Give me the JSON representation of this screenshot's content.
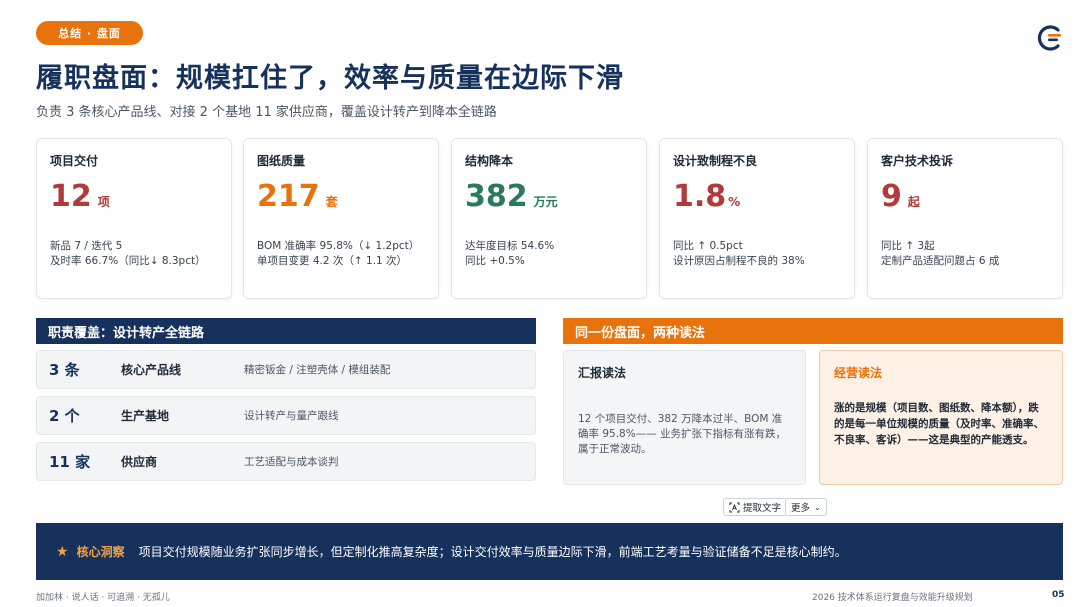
{
  "header": {
    "tag": "总结 · 盘面",
    "title": "履职盘面：规模扛住了，效率与质量在边际下滑",
    "subtitle": "负责 3 条核心产品线、对接 2 个基地 11 家供应商，覆盖设计转产到降本全链路"
  },
  "kpis": [
    {
      "label": "项目交付",
      "value": "12",
      "unit": "项",
      "color": "#b23a3a",
      "detail1": "新品 7 / 迭代 5",
      "detail2": "及时率 66.7%（同比↓ 8.3pct）"
    },
    {
      "label": "图纸质量",
      "value": "217",
      "unit": "套",
      "color": "#e8720c",
      "detail1": "BOM 准确率 95.8%（↓ 1.2pct）",
      "detail2": "单项目变更 4.2 次（↑ 1.1 次）"
    },
    {
      "label": "结构降本",
      "value": "382",
      "unit": "万元",
      "color": "#2b7a5a",
      "detail1": "达年度目标 54.6%",
      "detail2": "同比 +0.5%"
    },
    {
      "label": "设计致制程不良",
      "value": "1.8",
      "unit": "%",
      "color": "#b23a3a",
      "detail1": "同比 ↑ 0.5pct",
      "detail2": "设计原因占制程不良的 38%"
    },
    {
      "label": "客户技术投诉",
      "value": "9",
      "unit": "起",
      "color": "#b23a3a",
      "detail1": "同比 ↑ 3起",
      "detail2": "定制产品适配问题占 6 成"
    }
  ],
  "left_section": {
    "title": "职责覆盖：设计转产全链路",
    "rows": [
      {
        "count": "3 条",
        "name": "核心产品线",
        "desc": "精密钣金 / 注塑壳体 / 模组装配"
      },
      {
        "count": "2 个",
        "name": "生产基地",
        "desc": "设计转产与量产跟线"
      },
      {
        "count": "11 家",
        "name": "供应商",
        "desc": "工艺适配与成本谈判"
      }
    ]
  },
  "right_section": {
    "title": "同一份盘面，两种读法",
    "report": {
      "title": "汇报读法",
      "body": "12 个项目交付、382 万降本过半、BOM 准确率 95.8%—— 业务扩张下指标有涨有跌，属于正常波动。"
    },
    "business": {
      "title": "经营读法",
      "body": "涨的是规模（项目数、图纸数、降本额），跌的是每一单位规模的质量（及时率、准确率、不良率、客诉）——这是典型的产能透支。"
    }
  },
  "toolbar": {
    "extract_text": "提取文字",
    "more": "更多"
  },
  "insight": {
    "label": "核心洞察",
    "text": "项目交付规模随业务扩张同步增长，但定制化推高复杂度；设计交付效率与质量边际下滑，前端工艺考量与验证储备不足是核心制约。"
  },
  "footer": {
    "left": "加加林 · 说人话 · 可追溯 · 无孤儿",
    "right": "2026 技术体系运行复盘与效能升级规划",
    "page": "05"
  },
  "colors": {
    "navy": "#16325c",
    "orange": "#e8720c",
    "red": "#b23a3a",
    "green": "#2b7a5a"
  }
}
